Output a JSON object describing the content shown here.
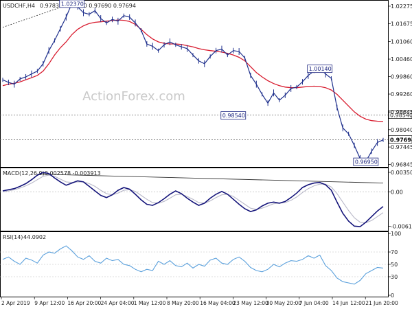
{
  "header": {
    "symbol": "USDCHF,H4",
    "ohlc": "0.97832 0.97850 0.97690 0.97694"
  },
  "watermark": "ActionForex.com",
  "colors": {
    "price": "#1e2f8c",
    "ma": "#d81b2e",
    "macd": "#14147a",
    "signal": "#b8b8c8",
    "rsi": "#5aa0dc",
    "trendline": "#333333",
    "level": "#666666",
    "grid_text": "#222222"
  },
  "chart_data": [
    {
      "type": "line",
      "name": "price",
      "ylim": [
        0.96835,
        1.02345
      ],
      "yticks": [
        "1.02275",
        "1.01675",
        "1.01060",
        "1.00460",
        "0.99860",
        "0.99260",
        "0.98645",
        "0.98040",
        "0.97445",
        "0.96845"
      ],
      "xticks": [
        "2 Apr 2019",
        "9 Apr 12:00",
        "16 Apr 20:00",
        "24 Apr 04:00",
        "1 May 12:00",
        "8 May 20:00",
        "16 May 04:00",
        "23 May 12:00",
        "30 May 20:00",
        "7 Jun 04:00",
        "14 Jun 12:00",
        "21 Jun 20:00"
      ],
      "price_series": [
        0.9975,
        0.9966,
        0.996,
        0.9978,
        0.9985,
        0.9995,
        1.0005,
        1.003,
        1.0075,
        1.011,
        1.015,
        1.019,
        1.0237,
        1.0225,
        1.0205,
        1.02,
        1.0212,
        1.0185,
        1.017,
        1.0182,
        1.0176,
        1.0195,
        1.019,
        1.017,
        1.0145,
        1.0098,
        1.009,
        1.0075,
        1.0095,
        1.0105,
        1.0095,
        1.0088,
        1.0082,
        1.006,
        1.004,
        1.003,
        1.0055,
        1.0075,
        1.008,
        1.006,
        1.0075,
        1.0072,
        1.005,
        0.999,
        0.996,
        0.9925,
        0.9895,
        0.993,
        0.9905,
        0.9922,
        0.9945,
        0.995,
        0.9968,
        0.999,
        1.0005,
        1.0014,
        0.9995,
        0.998,
        0.988,
        0.981,
        0.979,
        0.975,
        0.9705,
        0.9695,
        0.973,
        0.976,
        0.9769
      ],
      "ma_series": [
        0.9955,
        0.996,
        0.9963,
        0.9968,
        0.9975,
        0.9982,
        0.999,
        1.0005,
        1.003,
        1.006,
        1.0085,
        1.0105,
        1.013,
        1.0148,
        1.016,
        1.0168,
        1.0172,
        1.0174,
        1.0176,
        1.0178,
        1.018,
        1.0179,
        1.0175,
        1.0165,
        1.0148,
        1.013,
        1.0115,
        1.0105,
        1.01,
        1.0098,
        1.0098,
        1.0096,
        1.0092,
        1.0088,
        1.0082,
        1.0078,
        1.0075,
        1.0073,
        1.007,
        1.0066,
        1.006,
        1.0052,
        1.004,
        1.002,
        1.0,
        0.9985,
        0.9972,
        0.9962,
        0.9955,
        0.995,
        0.9948,
        0.9948,
        0.995,
        0.9952,
        0.9953,
        0.9952,
        0.9948,
        0.994,
        0.9925,
        0.9905,
        0.9885,
        0.9865,
        0.985,
        0.984,
        0.9835,
        0.9833,
        0.9832
      ],
      "price_labels": [
        {
          "text": "1.02370",
          "value": 1.0237,
          "index": 12
        },
        {
          "text": "1.00140",
          "value": 1.0014,
          "index": 55
        },
        {
          "text": "0.98540",
          "value": 0.9854,
          "index": 40
        },
        {
          "text": "0.96950",
          "value": 0.9695,
          "index": 63
        }
      ],
      "levels": [
        {
          "text": "0.98540",
          "value": 0.9854,
          "style": "dotted"
        },
        {
          "text": "0.97694",
          "value": 0.97694,
          "style": "dotted",
          "current": true
        }
      ],
      "trendline": {
        "from": [
          0,
          1.0155
        ],
        "to": [
          12,
          1.0237
        ]
      }
    },
    {
      "type": "line",
      "name": "MACD",
      "title": "MACD(12,26,9)",
      "values_label": "-0.002578 -0.003913",
      "ylim": [
        -0.0068,
        0.004
      ],
      "yticks": [
        "0.003508",
        "0.00",
        "-0.006121"
      ],
      "macd_series": [
        0.0002,
        0.0004,
        0.0006,
        0.001,
        0.0015,
        0.0022,
        0.003,
        0.0035,
        0.0033,
        0.0025,
        0.0018,
        0.0012,
        0.0016,
        0.002,
        0.0018,
        0.001,
        0.0002,
        -0.0006,
        -0.001,
        -0.0005,
        0.0003,
        0.0008,
        0.0005,
        -0.0004,
        -0.0014,
        -0.0022,
        -0.0024,
        -0.0019,
        -0.0012,
        -0.0004,
        0.0002,
        -0.0003,
        -0.0011,
        -0.0018,
        -0.0024,
        -0.002,
        -0.0011,
        -0.0004,
        0.0001,
        -0.0004,
        -0.0013,
        -0.0022,
        -0.003,
        -0.0035,
        -0.0032,
        -0.0025,
        -0.002,
        -0.0018,
        -0.002,
        -0.0017,
        -0.001,
        -0.0002,
        0.0008,
        0.0013,
        0.0016,
        0.0017,
        0.0013,
        0.0003,
        -0.0018,
        -0.0038,
        -0.0052,
        -0.0061,
        -0.0062,
        -0.0054,
        -0.0044,
        -0.0034,
        -0.0026
      ],
      "signal_series": [
        0.0,
        0.0002,
        0.0004,
        0.0007,
        0.0011,
        0.0016,
        0.0022,
        0.0028,
        0.003,
        0.0028,
        0.0023,
        0.0018,
        0.0017,
        0.0018,
        0.0018,
        0.0015,
        0.001,
        0.0003,
        -0.0003,
        -0.0005,
        -0.0002,
        0.0003,
        0.0004,
        0.0001,
        -0.0006,
        -0.0013,
        -0.0019,
        -0.002,
        -0.0017,
        -0.0011,
        -0.0005,
        -0.0004,
        -0.0008,
        -0.0013,
        -0.0019,
        -0.002,
        -0.0016,
        -0.001,
        -0.0005,
        -0.0004,
        -0.0008,
        -0.0015,
        -0.0022,
        -0.0029,
        -0.0031,
        -0.0029,
        -0.0025,
        -0.0021,
        -0.002,
        -0.0019,
        -0.0015,
        -0.0009,
        -0.0001,
        0.0006,
        0.0011,
        0.0014,
        0.0014,
        0.0009,
        -0.0003,
        -0.0018,
        -0.0033,
        -0.0046,
        -0.0054,
        -0.0055,
        -0.0051,
        -0.0044,
        -0.0037
      ],
      "trendline": {
        "from": [
          6,
          0.0032
        ],
        "to": [
          66,
          0.0016
        ]
      }
    },
    {
      "type": "line",
      "name": "RSI",
      "title": "RSI(14)",
      "values_label": "44.0902",
      "ylim": [
        0,
        100
      ],
      "yticks": [
        "100",
        "70",
        "50",
        "30",
        "0"
      ],
      "rsi_series": [
        58,
        62,
        55,
        50,
        60,
        57,
        52,
        65,
        70,
        68,
        75,
        80,
        72,
        62,
        58,
        64,
        55,
        52,
        60,
        56,
        58,
        50,
        48,
        42,
        38,
        42,
        40,
        55,
        50,
        56,
        48,
        46,
        52,
        44,
        50,
        47,
        57,
        60,
        52,
        50,
        58,
        62,
        55,
        45,
        40,
        38,
        42,
        50,
        46,
        52,
        56,
        55,
        58,
        64,
        60,
        65,
        48,
        40,
        28,
        22,
        20,
        18,
        24,
        35,
        40,
        45,
        44
      ]
    }
  ]
}
